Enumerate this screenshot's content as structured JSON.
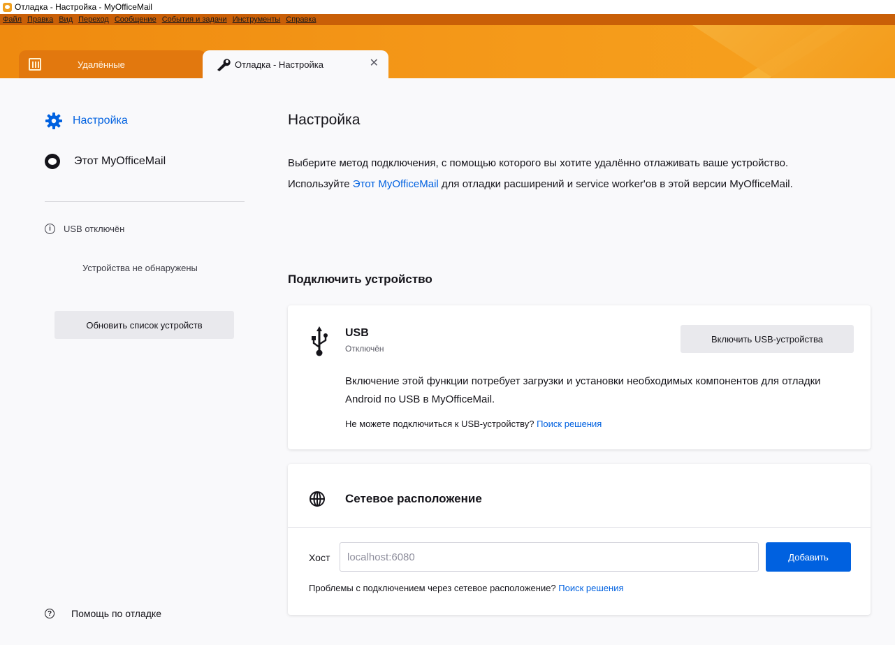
{
  "window": {
    "title": "Отладка - Настройка - MyOfficeMail"
  },
  "menu": [
    "Файл",
    "Правка",
    "Вид",
    "Переход",
    "Сообщение",
    "События и задачи",
    "Инструменты",
    "Справка"
  ],
  "tabs": {
    "deleted": {
      "label": "Удалённые",
      "icon": "trash-icon"
    },
    "active": {
      "label": "Отладка - Настройка",
      "icon": "wrench-icon"
    }
  },
  "sidebar": {
    "setup": "Настройка",
    "this_app": "Этот MyOfficeMail",
    "usb_status": "USB отключён",
    "no_devices": "Устройства не обнаружены",
    "refresh": "Обновить список устройств",
    "help": "Помощь по отладке"
  },
  "main": {
    "title": "Настройка",
    "intro_line1": "Выберите метод подключения, с помощью которого вы хотите удалённо отлаживать ваше устройство.",
    "intro_pre": "Используйте ",
    "intro_link": "Этот MyOfficeMail",
    "intro_post": " для отладки расширений и service worker'ов в этой версии MyOfficeMail.",
    "connect_title": "Подключить устройство",
    "usb": {
      "name": "USB",
      "state": "Отключён",
      "enable_button": "Включить USB-устройства",
      "description": "Включение этой функции потребует загрузки и установки необходимых компонентов для отладки Android по USB в MyOfficeMail.",
      "help_text": "Не можете подключиться к USB-устройству? ",
      "help_link": "Поиск решения"
    },
    "network": {
      "title": "Сетевое расположение",
      "host_label": "Хост",
      "host_placeholder": "localhost:6080",
      "add_button": "Добавить",
      "help_text": "Проблемы с подключением через сетевое расположение? ",
      "help_link": "Поиск решения"
    }
  },
  "colors": {
    "accent": "#0061e0",
    "tabstrip": "#ef8a0f",
    "menubar": "#c95f07"
  }
}
